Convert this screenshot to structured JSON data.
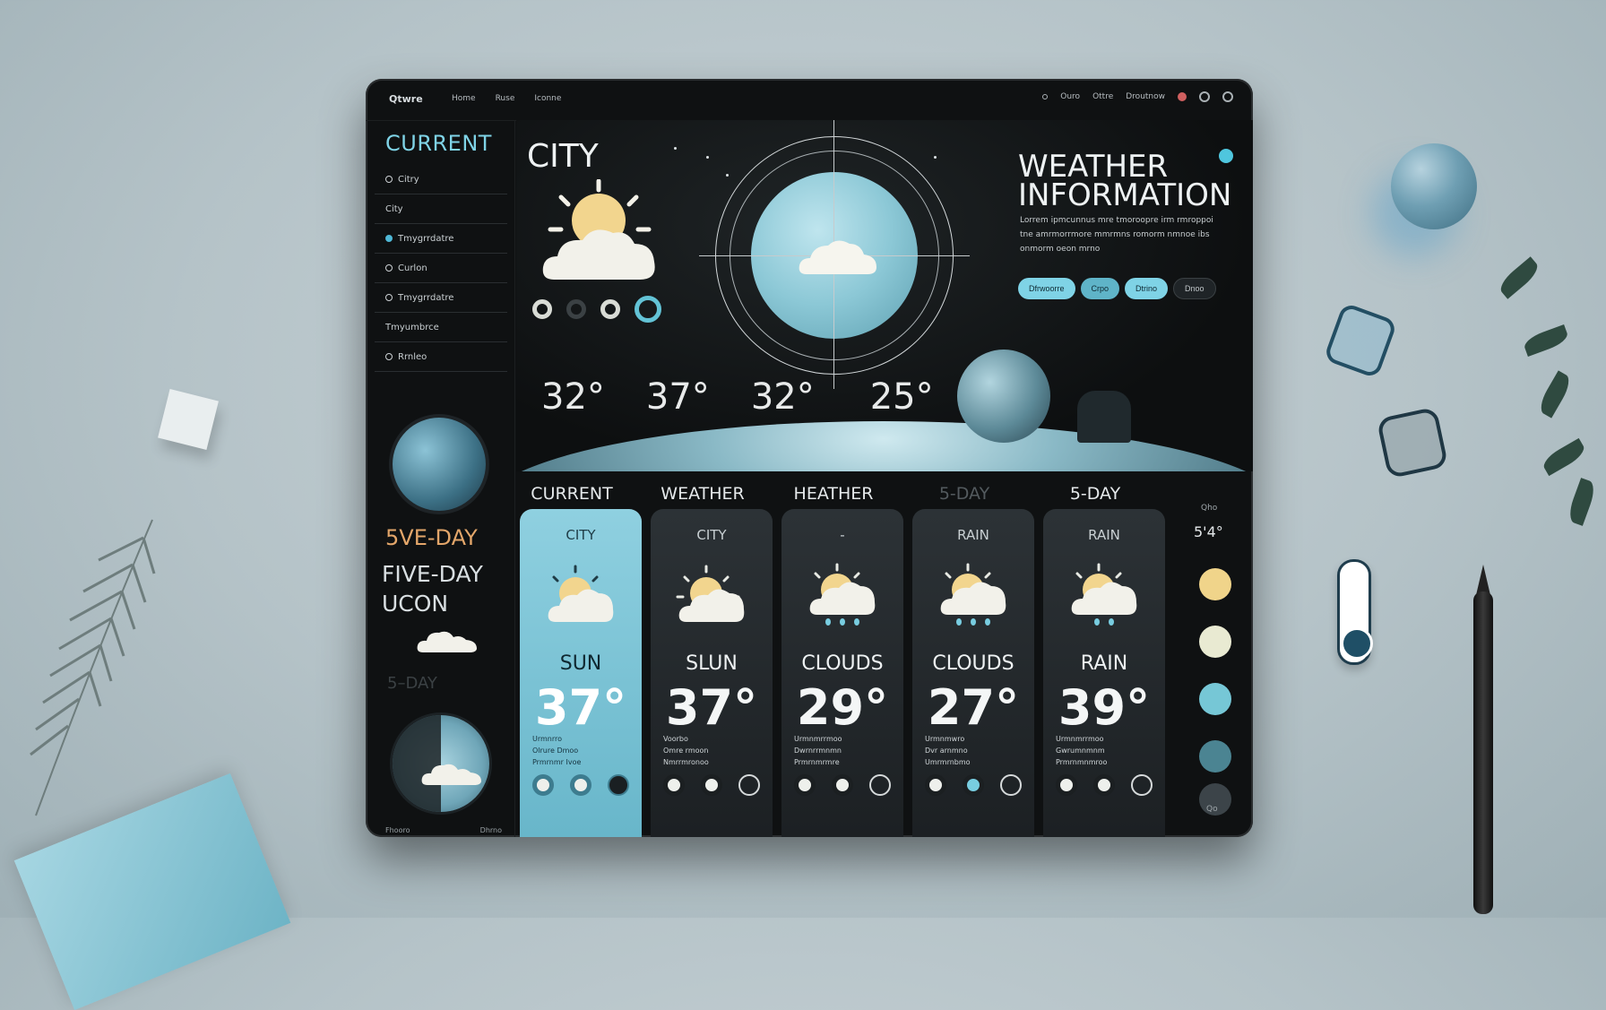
{
  "colors": {
    "accent": "#7fd3e6",
    "panel": "#0f1112",
    "card": "#2c3236",
    "card_active": "#8fd0e0",
    "sun": "#f2d58e",
    "cloud": "#f2f1ea"
  },
  "topbar": {
    "brand": "Qtwre",
    "nav": [
      "Home",
      "Ruse",
      "Iconne"
    ],
    "right": [
      "Ouro",
      "Ottre",
      "Droutnow"
    ],
    "icons": [
      "notification-icon",
      "settings-icon",
      "profile-icon"
    ]
  },
  "sidebar": {
    "title": "CURRENT",
    "items": [
      {
        "label": "Citry",
        "bullet": "outline"
      },
      {
        "label": "City",
        "bullet": "none"
      },
      {
        "label": "Tmygrrdatre",
        "bullet": "active"
      },
      {
        "label": "Curlon",
        "bullet": "outline"
      },
      {
        "label": "Tmygrrdatre",
        "bullet": "outline"
      },
      {
        "label": "Tmyumbrce",
        "bullet": "none"
      },
      {
        "label": "Rrnleo",
        "bullet": "outline"
      }
    ],
    "heading_5day": "5VE-DAY",
    "heading_fiveday": "FIVE-DAY UCON",
    "heading_faded": "5–DAY",
    "footer": [
      "Fhooro",
      "Dhrno"
    ]
  },
  "hero": {
    "city": "CITY",
    "title": "WEATHER INFORMATION",
    "description": "Lorrem ipmcunnus mre tmoroopre irm rmroppoi tne amrmorrmore mmrmns romorm nmnoe ibs onmorm oeon mrno",
    "buttons": [
      "Dfrwoorre",
      "Crpo",
      "Dtrino",
      "Dnoo"
    ],
    "temps": [
      "32°",
      "37°",
      "32°",
      "25°"
    ]
  },
  "forecast": {
    "cards": [
      {
        "head": "CURRENT",
        "sub": "CITY",
        "cond": "SUN",
        "temp": "37°",
        "icon": "sun-cloud-icon",
        "lines": [
          "Urmnrro",
          "Olrure Dmoo",
          "Prmrnmr Ivoe"
        ],
        "active": true
      },
      {
        "head": "WEATHER",
        "sub": "CITY",
        "cond": "SLUN",
        "temp": "37°",
        "icon": "sun-cloud-icon",
        "lines": [
          "Voorbo",
          "Omre rmoon",
          "Nmrrmronoo"
        ],
        "active": false
      },
      {
        "head": "HEATHER",
        "sub": "-",
        "cond": "CLOUDS",
        "temp": "29°",
        "icon": "rain-cloud-icon",
        "lines": [
          "Urmnmrrmoo",
          "Dwrnrrmnmn",
          "Prmrnmrmre"
        ],
        "active": false
      },
      {
        "head": "5-DAY",
        "sub": "RAIN",
        "cond": "CLOUDS",
        "temp": "27°",
        "icon": "rain-cloud-icon",
        "lines": [
          "Urmnmwro",
          "Dvr arnmno",
          "Umrmrnbmo"
        ],
        "active": false
      },
      {
        "head": "5-DAY",
        "sub": "RAIN",
        "cond": "RAIN",
        "temp": "39°",
        "icon": "rain-cloud-icon",
        "lines": [
          "Urmnmrrmoo",
          "Gwrumnmnm",
          "Prmrnmnmroo"
        ],
        "active": false
      }
    ]
  },
  "rail": {
    "top": "Qho",
    "value": "5'4°",
    "swatches": [
      "#f0d48a",
      "#e9ead2",
      "#76c7d6",
      "#4b8492",
      "#3c4449"
    ],
    "bottom": "Qo"
  }
}
